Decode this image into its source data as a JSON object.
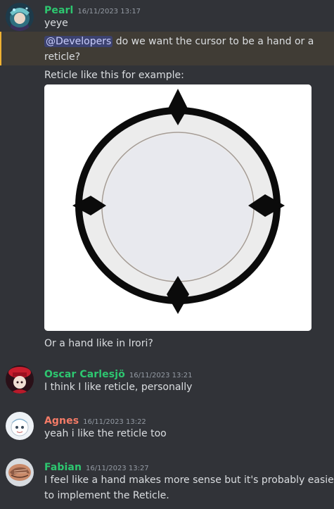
{
  "messages": [
    {
      "username": "Pearl",
      "username_color": "#2dc770",
      "timestamp": "16/11/2023 13:17",
      "lines": [
        "yeye"
      ],
      "mention_line": {
        "mention": "@Developers",
        "text_1": " do we want the cursor to be a hand or a",
        "text_2": "reticle?"
      },
      "caption": "Reticle like this for example:",
      "after_image": "Or a hand like in Irori?"
    },
    {
      "username": "Oscar Carlesjö",
      "username_color": "#2dc770",
      "timestamp": "16/11/2023 13:21",
      "text": "I think I like reticle, personally"
    },
    {
      "username": "Agnes",
      "username_color": "#f47b67",
      "timestamp": "16/11/2023 13:22",
      "text": "yeah i like the reticle too"
    },
    {
      "username": "Fabian",
      "username_color": "#2dc770",
      "timestamp": "16/11/2023 13:27",
      "text_1": "I feel like a hand makes more sense but it's probably easier",
      "text_2": "to implement the Reticle."
    }
  ],
  "colors": {
    "background": "#313338",
    "mention_highlight": "#403c35",
    "mention_bar": "#f0b232",
    "timestamp": "#949ba4"
  }
}
